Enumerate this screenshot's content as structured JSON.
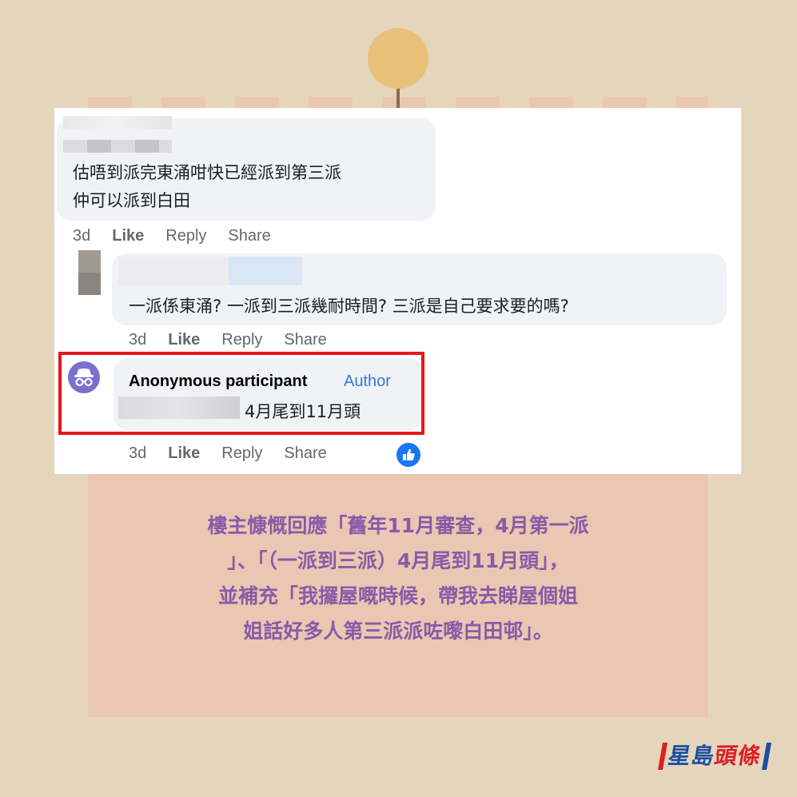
{
  "comments": [
    {
      "text_lines": [
        "估唔到派完東涌咁快已經派到第三派",
        "仲可以派到白田"
      ],
      "time": "3d",
      "like": "Like",
      "reply": "Reply",
      "share": "Share"
    },
    {
      "text_lines": [
        "一派係東涌? 一派到三派幾耐時間? 三派是自己要求要的嗎?"
      ],
      "time": "3d",
      "like": "Like",
      "reply": "Reply",
      "share": "Share"
    },
    {
      "author": "Anonymous participant",
      "badge": "Author",
      "text": "4月尾到11月頭",
      "time": "3d",
      "like": "Like",
      "reply": "Reply",
      "share": "Share"
    }
  ],
  "caption_lines": [
    "樓主慷慨回應「舊年11月審查，4月第一派",
    "」、「（一派到三派）4月尾到11月頭」，",
    "並補充「我攞屋嘅時候，帶我去睇屋個姐",
    "姐話好多人第三派派咗嚟白田邨」。"
  ],
  "logo": {
    "part1": "星島",
    "part2": "頭條"
  },
  "icons": {
    "avatar": "incognito-avatar-icon",
    "reaction": "thumbs-up-icon",
    "pin": "pushpin-icon"
  },
  "colors": {
    "background": "#e6d5bd",
    "board": "#eac7b2",
    "caption": "#8a5aa8",
    "highlight": "#e8151b",
    "author_badge": "#3578e5",
    "link_blue": "#1877f2"
  }
}
